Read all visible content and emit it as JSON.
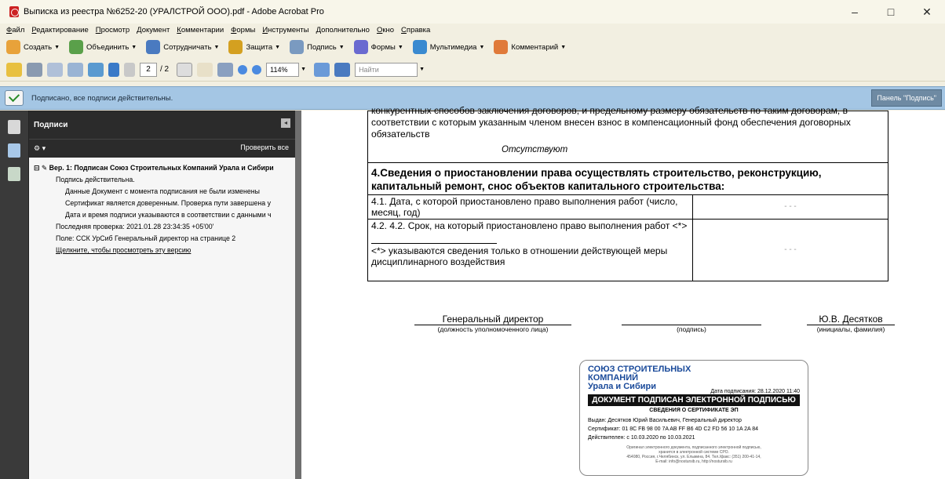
{
  "window": {
    "title": "Выписка из реестра №6252-20 (УРАЛСТРОЙ ООО).pdf - Adobe Acrobat Pro",
    "controls": [
      "–",
      "□",
      "✕"
    ]
  },
  "menu": [
    "Файл",
    "Редактирование",
    "Просмотр",
    "Документ",
    "Комментарии",
    "Формы",
    "Инструменты",
    "Дополнительно",
    "Окно",
    "Справка"
  ],
  "toolbar1": [
    {
      "label": "Создать",
      "icon": "create-pdf-icon",
      "color": "#e8a23a"
    },
    {
      "label": "Объединить",
      "icon": "combine-icon",
      "color": "#5aa04a"
    },
    {
      "label": "Сотрудничать",
      "icon": "collaborate-icon",
      "color": "#4a7ac0"
    },
    {
      "label": "Защита",
      "icon": "lock-icon",
      "color": "#d4a020"
    },
    {
      "label": "Подпись",
      "icon": "pen-icon",
      "color": "#7a9ac0"
    },
    {
      "label": "Формы",
      "icon": "forms-icon",
      "color": "#6a6ad0"
    },
    {
      "label": "Мультимедиа",
      "icon": "multimedia-icon",
      "color": "#3a8ad0"
    },
    {
      "label": "Комментарий",
      "icon": "comment-icon",
      "color": "#e07a3a"
    }
  ],
  "toolbar2": {
    "page_current": "2",
    "page_total": "/ 2",
    "zoom": "114%",
    "find_placeholder": "Найти"
  },
  "sigbar": {
    "message": "Подписано, все подписи действительны.",
    "panel_button": "Панель \"Подпись\""
  },
  "panel": {
    "title": "Подписи",
    "verify_all": "Проверить все",
    "tree": {
      "rev": "Вер. 1: Подписан Союз Строительных Компаний Урала и Сибири",
      "valid": "Подпись действительна.",
      "unchanged": "Данные Документ с момента подписания не были изменены",
      "trusted": "Сертификат является доверенным. Проверка пути завершена у",
      "time": "Дата и время подписи указываются в соответствии с данными ч",
      "last_check": "Последняя проверка: 2021.01.28 23:34:35 +05'00'",
      "field": "Поле: ССК УрСиб Генеральный директор на странице 2",
      "view_link": "Щелкните, чтобы просмотреть эту версию"
    }
  },
  "document": {
    "top_cut": "конкурентных способов заключения договоров, и предельному размеру обязательств по таким договорам, в",
    "top_line2": "соответствии с которым указанным членом внесен взнос в компенсационный фонд обеспечения договорных",
    "top_line3": "обязательств",
    "absent": "Отсутствуют",
    "heading": "4.Сведения о приостановлении права осуществлять строительство, реконструкцию, капитальный ремонт, снос объектов капитального строительства:",
    "row1_left": "4.1. Дата, с которой приостановлено право выполнения работ (число, месяц, год)",
    "row1_right": "- - -",
    "row2_left": "4.2. 4.2. Срок, на который приостановлено право выполнения работ <*>",
    "row2_note": "<*> указываются сведения только в отношении действующей меры дисциплинарного воздействия",
    "row2_right": "- - -",
    "sign_position": "Генеральный директор",
    "sign_position_cap": "(должность уполномоченного лица)",
    "sign_cap": "(подпись)",
    "sign_name": "Ю.В. Десятков",
    "sign_name_cap": "(инициалы, фамилия)"
  },
  "stamp": {
    "brand1": "СОЮЗ СТРОИТЕЛЬНЫХ",
    "brand2": "КОМПАНИЙ",
    "brand3": "Урала и Сибири",
    "date": "Дата подписания: 28.12.2020 11:40",
    "banner": "ДОКУМЕНТ ПОДПИСАН ЭЛЕКТРОННОЙ ПОДПИСЬЮ",
    "cert_head": "СВЕДЕНИЯ О СЕРТИФИКАТЕ ЭП",
    "issued": "Выдан: Десятков Юрий Васильевич, Генеральный директор",
    "cert": "Сертификат: 01 8C FB 98 00 7A AB FF B6 4D C2 FD 56 10 1A 2A 84",
    "valid": "Действителен: с 10.03.2020 по 10.03.2021",
    "fine1": "Оригинал электронного документа, подписанного электронной подписью,",
    "fine2": "хранится в электронной системе СРО.",
    "fine3": "454080, Россия, г.Челябинск, ул. Ельмина, 84. Тел./факс: (351) 200-41-14,",
    "fine4": "E-mail: info@nostursib.ru, http://nostursib.ru"
  }
}
